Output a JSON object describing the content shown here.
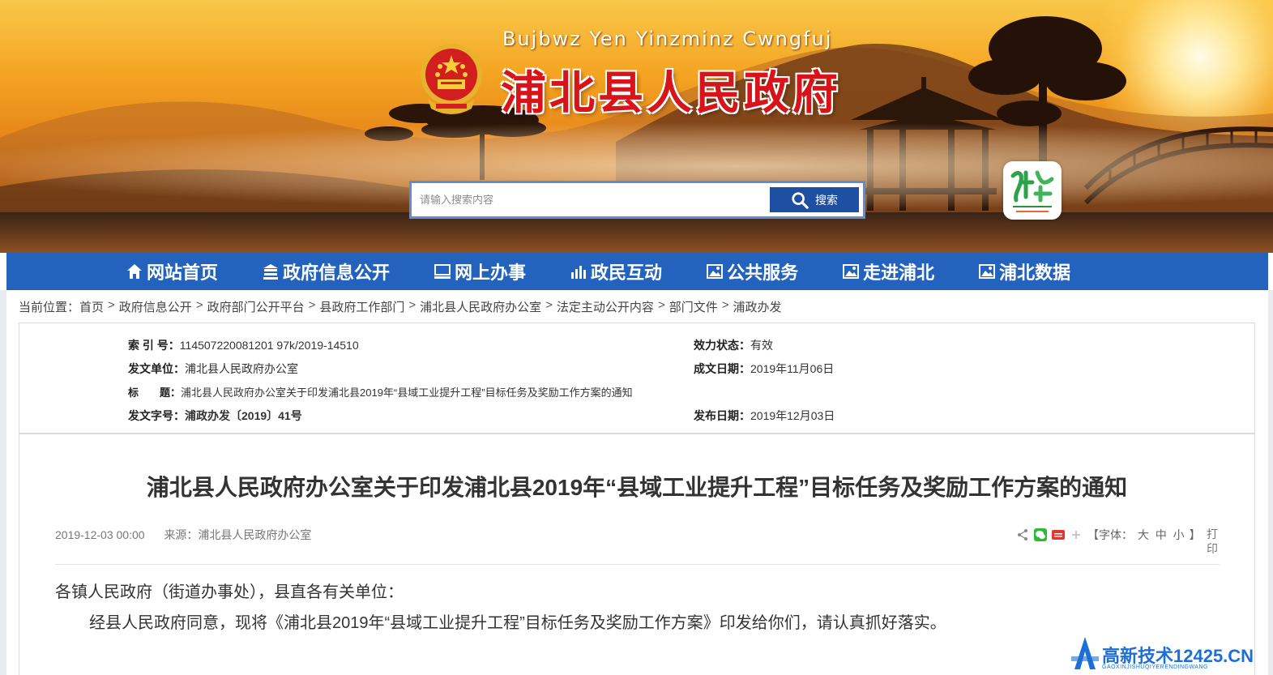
{
  "header": {
    "pinyin_title": "Bujbwz Yen Yinzminz Cwngfuj",
    "title": "浦北县人民政府",
    "search": {
      "placeholder": "请输入搜索内容",
      "button_label": "搜索"
    }
  },
  "nav": {
    "items": [
      {
        "label": "网站首页",
        "icon": "home-icon"
      },
      {
        "label": "政府信息公开",
        "icon": "building-icon"
      },
      {
        "label": "网上办事",
        "icon": "monitor-icon"
      },
      {
        "label": "政民互动",
        "icon": "chart-icon"
      },
      {
        "label": "公共服务",
        "icon": "image-icon"
      },
      {
        "label": "走进浦北",
        "icon": "image-icon"
      },
      {
        "label": "浦北数据",
        "icon": "image-icon"
      }
    ]
  },
  "breadcrumb": {
    "prefix": "当前位置：",
    "items": [
      "首页",
      "政府信息公开",
      "政府部门公开平台",
      "县政府工作部门",
      "浦北县人民政府办公室",
      "法定主动公开内容",
      "部门文件",
      "浦政办发"
    ]
  },
  "meta": {
    "index_no": {
      "key": "索 引 号：",
      "value": "114507220081201 97k/2019-14510"
    },
    "issuer": {
      "key": "发文单位：",
      "value": "浦北县人民政府办公室"
    },
    "subject": {
      "key": "标　　题：",
      "value": "浦北县人民政府办公室关于印发浦北县2019年“县域工业提升工程”目标任务及奖励工作方案的通知"
    },
    "doc_no": {
      "key": "发文字号：",
      "value": "浦政办发〔2019〕41号"
    },
    "validity": {
      "key": "效力状态：",
      "value": "有效"
    },
    "created": {
      "key": "成文日期：",
      "value": "2019年11月06日"
    },
    "published": {
      "key": "发布日期：",
      "value": "2019年12月03日"
    }
  },
  "article": {
    "title": "浦北县人民政府办公室关于印发浦北县2019年“县域工业提升工程”目标任务及奖励工作方案的通知",
    "datetime": "2019-12-03 00:00",
    "source": "来源：浦北县人民政府办公室",
    "font_size_prefix": "【字体：",
    "font_sizes": [
      "大",
      "中",
      "小"
    ],
    "font_size_suffix": "】",
    "print_label": "打印",
    "greeting": "各镇人民政府（街道办事处），县直各有关单位：",
    "body": "经县人民政府同意，现将《浦北县2019年“县域工业提升工程”目标任务及奖励工作方案》印发给你们，请认真抓好落实。"
  },
  "watermark": {
    "text": "高新技术12425.CN",
    "subtext": "GAOXINJISHUQIYERENDINGWANG"
  },
  "colors": {
    "nav_bg": "#2463bd",
    "title_red": "#d6141a",
    "search_btn": "#1d4fa3"
  }
}
